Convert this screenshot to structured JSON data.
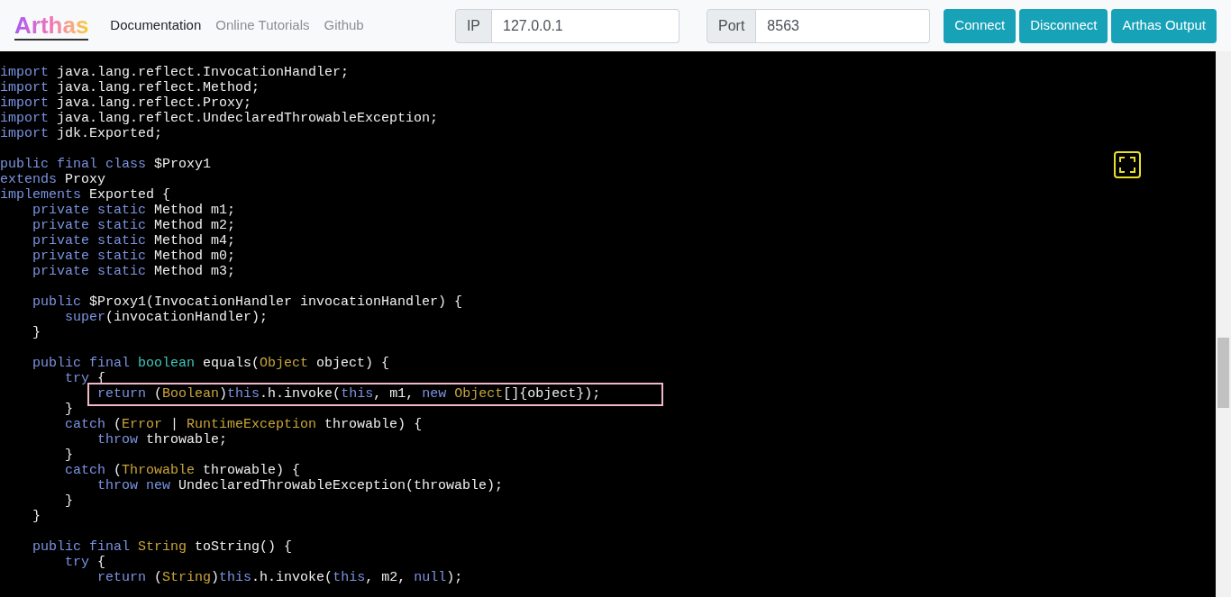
{
  "header": {
    "logo": "Arthas",
    "nav": [
      {
        "label": "Documentation",
        "selected": true
      },
      {
        "label": "Online Tutorials",
        "selected": false
      },
      {
        "label": "Github",
        "selected": false
      }
    ],
    "ip": {
      "label": "IP",
      "value": "127.0.0.1"
    },
    "port": {
      "label": "Port",
      "value": "8563"
    },
    "buttons": [
      "Connect",
      "Disconnect",
      "Arthas Output"
    ]
  },
  "code": {
    "blocks": [
      {
        "lines": [
          {
            "kind": "normal",
            "tokens": [
              {
                "kind": "keyword",
                "text": "import"
              },
              {
                "kind": "plain",
                "text": " java.lang.reflect.InvocationHandler;"
              }
            ]
          },
          {
            "kind": "normal",
            "tokens": [
              {
                "kind": "keyword",
                "text": "import"
              },
              {
                "kind": "plain",
                "text": " java.lang.reflect.Method;"
              }
            ]
          },
          {
            "kind": "normal",
            "tokens": [
              {
                "kind": "keyword",
                "text": "import"
              },
              {
                "kind": "plain",
                "text": " java.lang.reflect.Proxy;"
              }
            ]
          },
          {
            "kind": "normal",
            "tokens": [
              {
                "kind": "keyword",
                "text": "import"
              },
              {
                "kind": "plain",
                "text": " java.lang.reflect.UndeclaredThrowableException;"
              }
            ]
          },
          {
            "kind": "normal",
            "tokens": [
              {
                "kind": "keyword",
                "text": "import"
              },
              {
                "kind": "plain",
                "text": " jdk.Exported;"
              }
            ]
          }
        ]
      },
      {
        "lines": [
          {
            "kind": "normal",
            "tokens": [
              {
                "kind": "keyword",
                "text": "public final class"
              },
              {
                "kind": "plain",
                "text": " $Proxy1"
              }
            ]
          },
          {
            "kind": "normal",
            "tokens": [
              {
                "kind": "keyword",
                "text": "extends"
              },
              {
                "kind": "plain",
                "text": " Proxy"
              }
            ]
          },
          {
            "kind": "normal",
            "tokens": [
              {
                "kind": "keyword",
                "text": "implements"
              },
              {
                "kind": "plain",
                "text": " Exported {"
              }
            ]
          },
          {
            "kind": "normal",
            "tokens": [
              {
                "kind": "keyword",
                "text": "    private static"
              },
              {
                "kind": "plain",
                "text": " Method m1;"
              }
            ]
          },
          {
            "kind": "normal",
            "tokens": [
              {
                "kind": "keyword",
                "text": "    private static"
              },
              {
                "kind": "plain",
                "text": " Method m2;"
              }
            ]
          },
          {
            "kind": "normal",
            "tokens": [
              {
                "kind": "keyword",
                "text": "    private static"
              },
              {
                "kind": "plain",
                "text": " Method m4;"
              }
            ]
          },
          {
            "kind": "normal",
            "tokens": [
              {
                "kind": "keyword",
                "text": "    private static"
              },
              {
                "kind": "plain",
                "text": " Method m0;"
              }
            ]
          },
          {
            "kind": "normal",
            "tokens": [
              {
                "kind": "keyword",
                "text": "    private static"
              },
              {
                "kind": "plain",
                "text": " Method m3;"
              }
            ]
          }
        ]
      },
      {
        "lines": [
          {
            "kind": "normal",
            "tokens": [
              {
                "kind": "keyword",
                "text": "    public"
              },
              {
                "kind": "plain",
                "text": " $Proxy1(InvocationHandler invocationHandler) {"
              }
            ]
          },
          {
            "kind": "normal",
            "tokens": [
              {
                "kind": "keyword",
                "text": "        super"
              },
              {
                "kind": "plain",
                "text": "(invocationHandler);"
              }
            ]
          },
          {
            "kind": "normal",
            "tokens": [
              {
                "kind": "plain",
                "text": "    }"
              }
            ]
          }
        ]
      },
      {
        "lines": [
          {
            "kind": "normal",
            "tokens": [
              {
                "kind": "keyword",
                "text": "    public final "
              },
              {
                "kind": "type",
                "text": "boolean"
              },
              {
                "kind": "plain",
                "text": " equals("
              },
              {
                "kind": "class",
                "text": "Object"
              },
              {
                "kind": "plain",
                "text": " object) {"
              }
            ]
          },
          {
            "kind": "normal",
            "tokens": [
              {
                "kind": "keyword",
                "text": "        try"
              },
              {
                "kind": "plain",
                "text": " {"
              }
            ]
          },
          {
            "kind": "boxed",
            "tokens": [
              {
                "kind": "keyword",
                "text": "            return"
              },
              {
                "kind": "plain",
                "text": " ("
              },
              {
                "kind": "class",
                "text": "Boolean"
              },
              {
                "kind": "plain",
                "text": ")"
              },
              {
                "kind": "keyword",
                "text": "this"
              },
              {
                "kind": "plain",
                "text": ".h.invoke("
              },
              {
                "kind": "keyword",
                "text": "this"
              },
              {
                "kind": "plain",
                "text": ", m1, "
              },
              {
                "kind": "keyword",
                "text": "new "
              },
              {
                "kind": "class",
                "text": "Object"
              },
              {
                "kind": "plain",
                "text": "[]{object});"
              }
            ]
          },
          {
            "kind": "normal",
            "tokens": [
              {
                "kind": "plain",
                "text": "        }"
              }
            ]
          },
          {
            "kind": "normal",
            "tokens": [
              {
                "kind": "keyword",
                "text": "        catch"
              },
              {
                "kind": "plain",
                "text": " ("
              },
              {
                "kind": "class",
                "text": "Error"
              },
              {
                "kind": "plain",
                "text": " | "
              },
              {
                "kind": "class",
                "text": "RuntimeException"
              },
              {
                "kind": "plain",
                "text": " throwable) {"
              }
            ]
          },
          {
            "kind": "normal",
            "tokens": [
              {
                "kind": "keyword",
                "text": "            throw"
              },
              {
                "kind": "plain",
                "text": " throwable;"
              }
            ]
          },
          {
            "kind": "normal",
            "tokens": [
              {
                "kind": "plain",
                "text": "        }"
              }
            ]
          },
          {
            "kind": "normal",
            "tokens": [
              {
                "kind": "keyword",
                "text": "        catch"
              },
              {
                "kind": "plain",
                "text": " ("
              },
              {
                "kind": "class",
                "text": "Throwable"
              },
              {
                "kind": "plain",
                "text": " throwable) {"
              }
            ]
          },
          {
            "kind": "normal",
            "tokens": [
              {
                "kind": "keyword",
                "text": "            throw new"
              },
              {
                "kind": "plain",
                "text": " UndeclaredThrowableException(throwable);"
              }
            ]
          },
          {
            "kind": "normal",
            "tokens": [
              {
                "kind": "plain",
                "text": "        }"
              }
            ]
          },
          {
            "kind": "normal",
            "tokens": [
              {
                "kind": "plain",
                "text": "    }"
              }
            ]
          }
        ]
      },
      {
        "lines": [
          {
            "kind": "normal",
            "tokens": [
              {
                "kind": "keyword",
                "text": "    public final "
              },
              {
                "kind": "class",
                "text": "String"
              },
              {
                "kind": "plain",
                "text": " toString() {"
              }
            ]
          },
          {
            "kind": "normal",
            "tokens": [
              {
                "kind": "keyword",
                "text": "        try"
              },
              {
                "kind": "plain",
                "text": " {"
              }
            ]
          },
          {
            "kind": "normal",
            "tokens": [
              {
                "kind": "keyword",
                "text": "            return"
              },
              {
                "kind": "plain",
                "text": " ("
              },
              {
                "kind": "class",
                "text": "String"
              },
              {
                "kind": "plain",
                "text": ")"
              },
              {
                "kind": "keyword",
                "text": "this"
              },
              {
                "kind": "plain",
                "text": ".h.invoke("
              },
              {
                "kind": "keyword",
                "text": "this"
              },
              {
                "kind": "plain",
                "text": ", m2, "
              },
              {
                "kind": "keyword",
                "text": "null"
              },
              {
                "kind": "plain",
                "text": ");"
              }
            ]
          }
        ]
      }
    ]
  }
}
